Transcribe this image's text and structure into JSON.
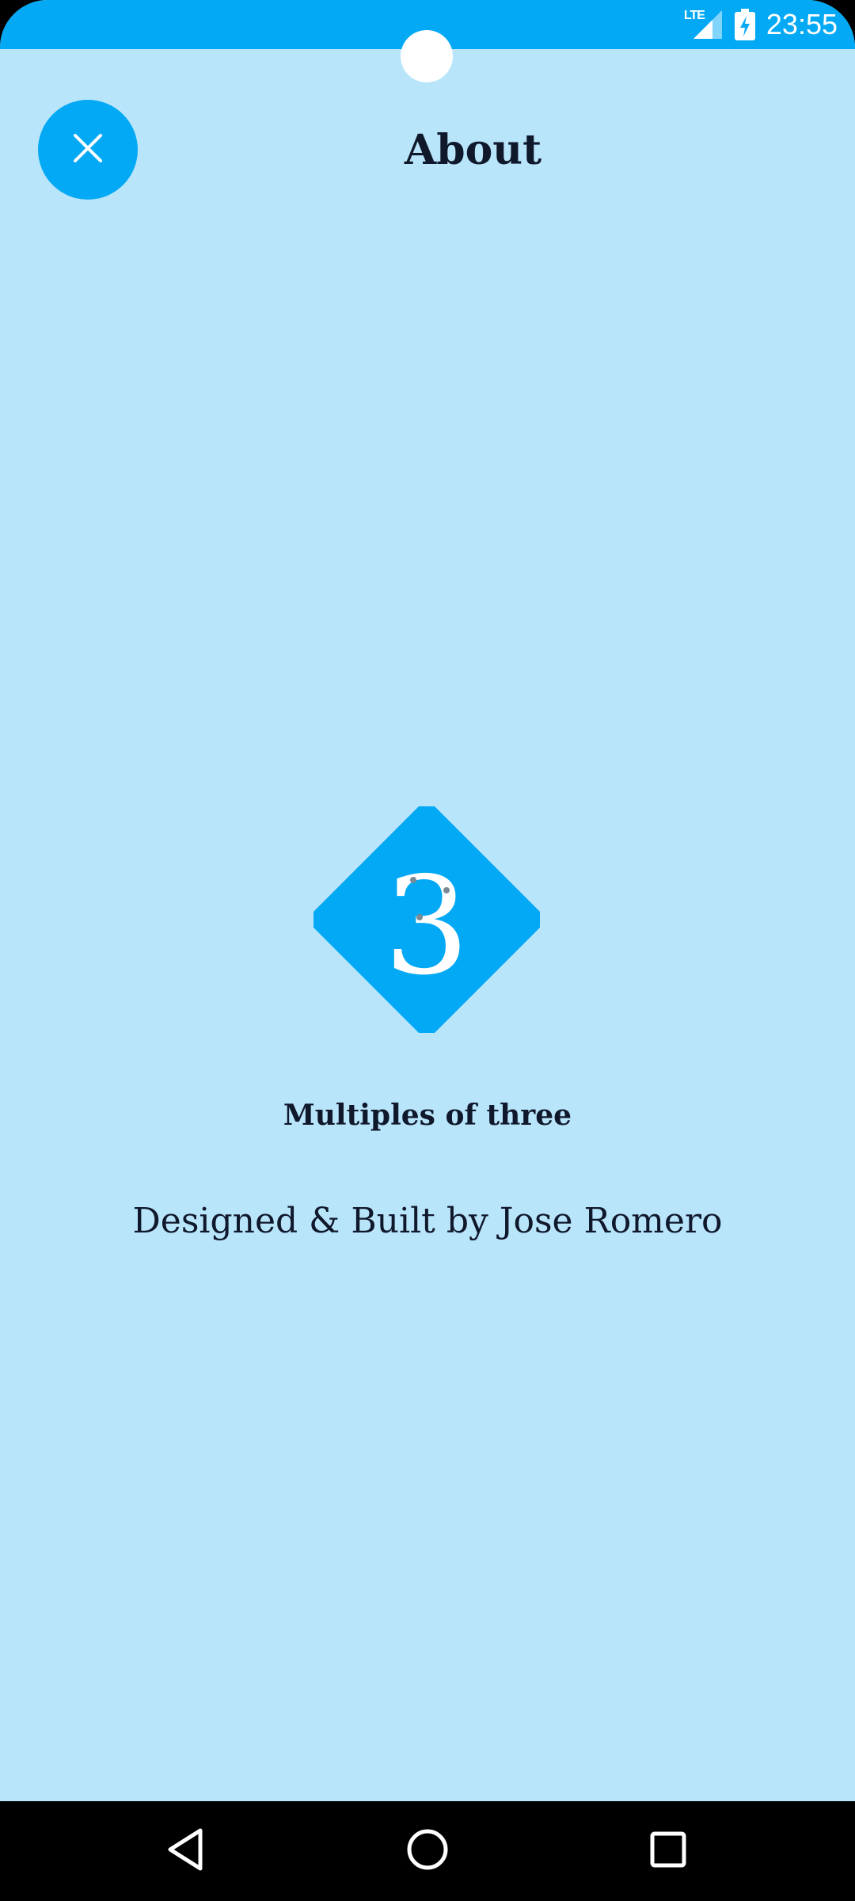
{
  "status_bar": {
    "network_label": "LTE",
    "time": "23:55",
    "background_color": "#03a9f4"
  },
  "header": {
    "title": "About",
    "close_icon": "close-icon"
  },
  "logo": {
    "digit": "3",
    "accent_color": "#03a9f4"
  },
  "about": {
    "app_name": "Multiples of three",
    "credit": "Designed & Built by Jose Romero"
  },
  "nav_bar": {
    "back_icon": "back-triangle-icon",
    "home_icon": "home-circle-icon",
    "recents_icon": "recents-square-icon"
  },
  "colors": {
    "background": "#b9e5fb",
    "accent": "#03a9f4",
    "text": "#10182b"
  }
}
